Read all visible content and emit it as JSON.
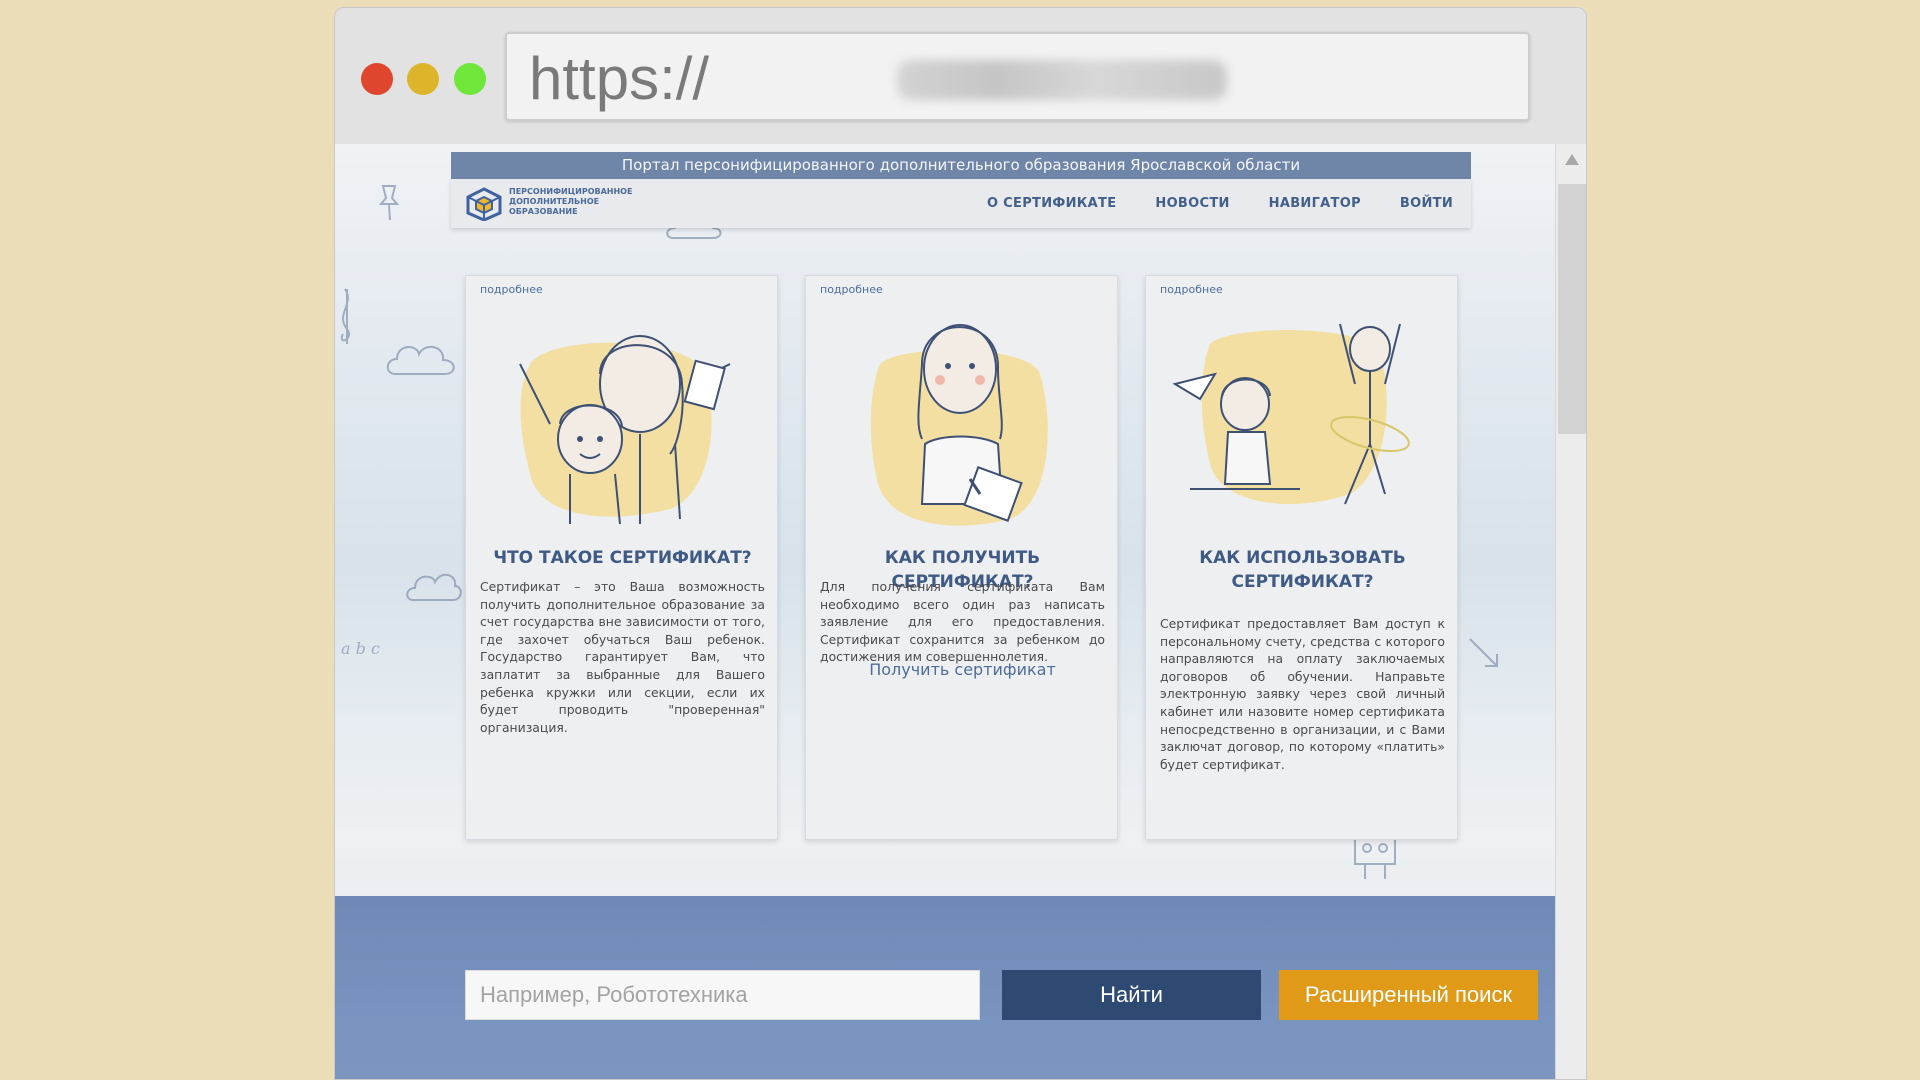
{
  "browser": {
    "url_prefix": "https://"
  },
  "site": {
    "top_banner": "Портал персонифицированного дополнительного образования Ярославской области",
    "logo_text": "ПЕРСОНИФИЦИРОВАННОЕ ДОПОЛНИТЕЛЬНОЕ ОБРАЗОВАНИЕ",
    "nav": [
      {
        "label": "О СЕРТИФИКАТЕ"
      },
      {
        "label": "НОВОСТИ"
      },
      {
        "label": "НАВИГАТОР"
      },
      {
        "label": "ВОЙТИ"
      }
    ]
  },
  "cards": [
    {
      "more": "подробнее",
      "title": "ЧТО ТАКОЕ СЕРТИФИКАТ?",
      "text": "Сертификат – это Ваша возможность получить дополнительное образование за счет государства вне зависимости от того, где захочет обучаться Ваш ребенок. Государство гарантирует Вам, что заплатит за выбранные для Вашего ребенка кружки или секции, если их будет проводить \"проверенная\" организация."
    },
    {
      "more": "подробнее",
      "title": "КАК ПОЛУЧИТЬ СЕРТИФИКАТ?",
      "text": "Для получения сертификата Вам необходимо всего один раз написать заявление для его предоставления. Сертификат сохранится за ребенком до достижения им совершеннолетия.",
      "link": "Получить сертификат"
    },
    {
      "more": "подробнее",
      "title": "КАК ИСПОЛЬЗОВАТЬ СЕРТИФИКАТ?",
      "text": "Сертификат предоставляет Вам доступ к персональному счету, средства с которого направляются на оплату заключаемых договоров об обучении. Направьте электронную заявку через свой личный кабинет или назовите номер сертификата непосредственно в организации, и с Вами заключат договор, по которому «платить» будет сертификат."
    }
  ],
  "search": {
    "placeholder": "Например, Робототехника",
    "find_label": "Найти",
    "advanced_label": "Расширенный поиск"
  },
  "colors": {
    "banner": "#6f86a8",
    "nav_text": "#43608a",
    "find_button": "#2e4a73",
    "advanced_button": "#e09a18",
    "illustration_accent": "#f3dfa2"
  }
}
